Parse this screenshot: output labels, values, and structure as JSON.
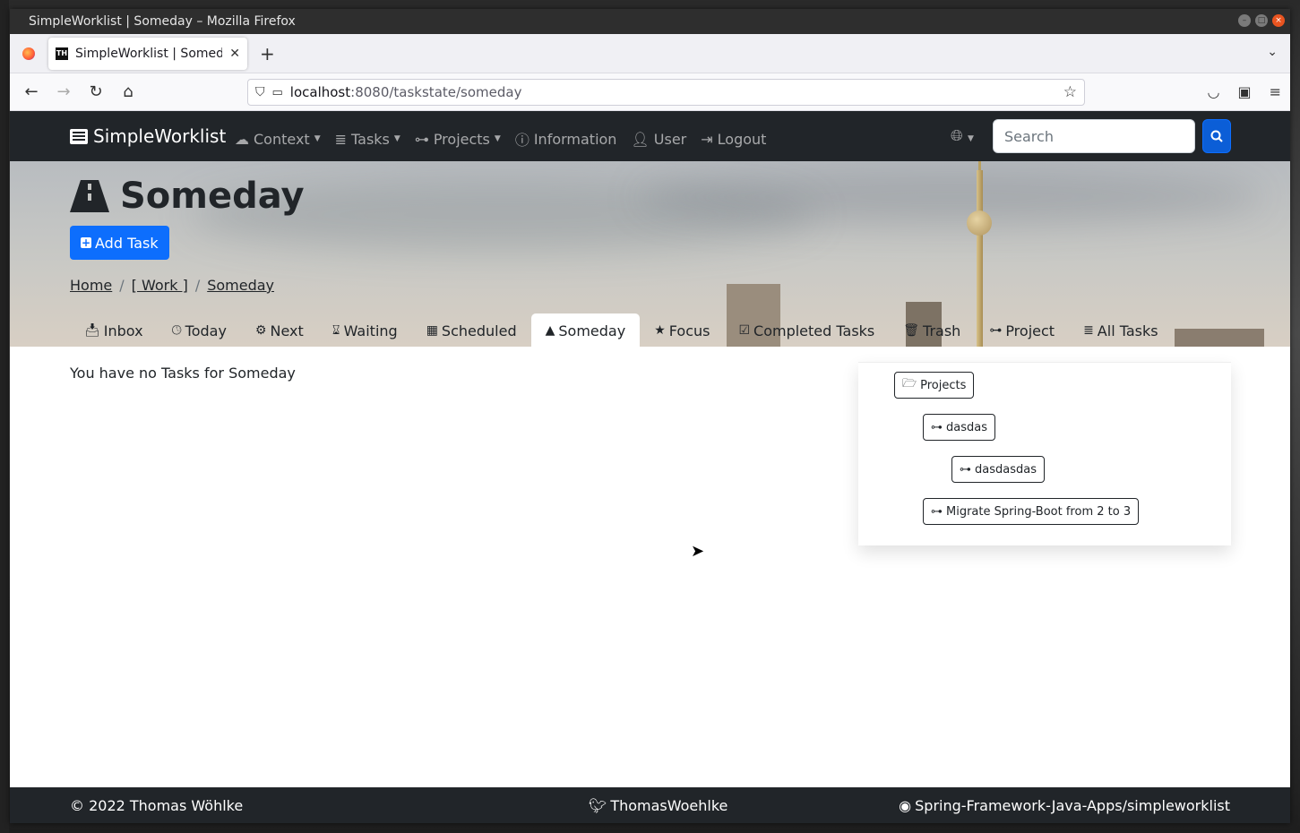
{
  "window": {
    "title": "SimpleWorklist | Someday – Mozilla Firefox"
  },
  "browser": {
    "tab_label": "SimpleWorklist | Someday",
    "url_host": "localhost",
    "url_path": ":8080/taskstate/someday"
  },
  "app": {
    "brand": "SimpleWorklist",
    "menu": [
      {
        "label": "Context",
        "icon": "cloud-icon",
        "dropdown": true
      },
      {
        "label": "Tasks",
        "icon": "database-icon",
        "dropdown": true
      },
      {
        "label": "Projects",
        "icon": "project-diagram-icon",
        "dropdown": true
      },
      {
        "label": "Information",
        "icon": "info-icon",
        "dropdown": false
      },
      {
        "label": "User",
        "icon": "user-icon",
        "dropdown": false
      },
      {
        "label": "Logout",
        "icon": "logout-icon",
        "dropdown": false
      }
    ],
    "search_placeholder": "Search"
  },
  "page": {
    "title": "Someday",
    "add_task_label": "Add Task",
    "breadcrumb": [
      "Home",
      "[ Work ]",
      "Someday"
    ],
    "tabs": [
      {
        "label": "Inbox",
        "icon": "inbox-icon",
        "active": false
      },
      {
        "label": "Today",
        "icon": "clock-icon",
        "active": false
      },
      {
        "label": "Next",
        "icon": "cogs-icon",
        "active": false
      },
      {
        "label": "Waiting",
        "icon": "hourglass-icon",
        "active": false
      },
      {
        "label": "Scheduled",
        "icon": "calendar-icon",
        "active": false
      },
      {
        "label": "Someday",
        "icon": "road-icon",
        "active": true
      },
      {
        "label": "Focus",
        "icon": "star-icon",
        "active": false
      },
      {
        "label": "Completed Tasks",
        "icon": "check-square-icon",
        "active": false
      },
      {
        "label": "Trash",
        "icon": "trash-icon",
        "active": false
      },
      {
        "label": "Project",
        "icon": "project-diagram-icon",
        "active": false
      },
      {
        "label": "All Tasks",
        "icon": "database-icon",
        "active": false
      }
    ],
    "empty_message": "You have no Tasks for Someday"
  },
  "projects_tree": {
    "root": "Projects",
    "items": [
      "dasdas",
      "dasdasdas",
      "Migrate Spring-Boot from 2 to 3"
    ]
  },
  "footer": {
    "copyright": "© 2022 Thomas Wöhlke",
    "twitter": "ThomasWoehlke",
    "github": "Spring-Framework-Java-Apps/simpleworklist"
  },
  "colors": {
    "navbar": "#212529",
    "primary": "#0d6efd"
  }
}
